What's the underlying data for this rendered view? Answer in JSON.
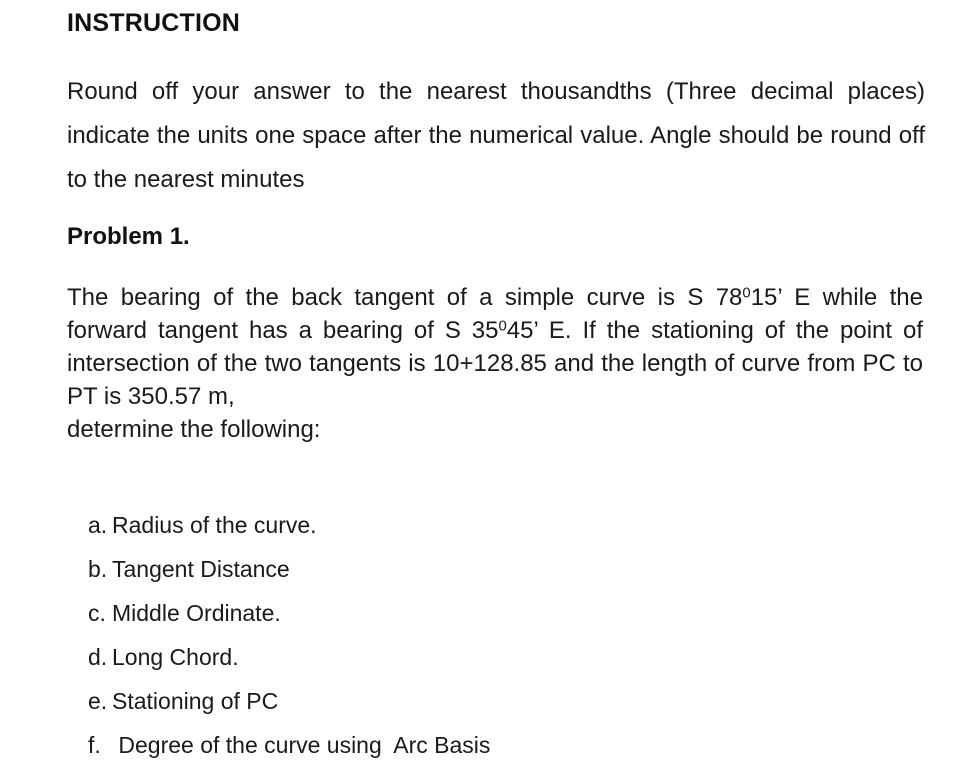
{
  "document": {
    "heading": "INSTRUCTION",
    "instruction_paragraph": "Round off your answer to the nearest thousandths (Three decimal places) indicate the units one space after the numerical value. Angle should be round off to the nearest minutes",
    "problem_label": "Problem 1.",
    "problem_statement": {
      "line_1_pre_bearing": "The bearing of the back tangent of a simple curve is  S 78",
      "back_tangent_degrees": "78",
      "back_tangent_minutes": "15",
      "back_tangent_bearing_full": "S 78⁰15' E",
      "forward_tangent_degrees": "35",
      "forward_tangent_minutes": "45",
      "forward_tangent_bearing_full": "S 35⁰45' E",
      "station_of_intersection": "10+128.85",
      "length_of_curve": "350.57 m",
      "full_text_segment_a": "The bearing of the back tangent of a simple curve is  S 78",
      "superscript_zero": "0",
      "full_text_segment_b": "15’ E while the forward tangent has a bearing of S 35",
      "full_text_segment_c": "45’ E. If the stationing of the point of intersection of the two tangents is 10+128.85 and the length of curve from PC to PT is 350.57 m,",
      "last_line": "determine the following:"
    },
    "questions": [
      {
        "marker": "a.",
        "text": "Radius of the curve."
      },
      {
        "marker": "b.",
        "text": "Tangent Distance"
      },
      {
        "marker": "c.",
        "text": "Middle Ordinate."
      },
      {
        "marker": "d.",
        "text": "Long Chord."
      },
      {
        "marker": "e.",
        "text": "Stationing of PC"
      },
      {
        "marker": "f.",
        "text": " Degree of the curve using  Arc Basis"
      }
    ],
    "colors": {
      "page_background": "#ffffff",
      "body_text": "#1a1a1a",
      "heading_text": "#111111"
    }
  }
}
